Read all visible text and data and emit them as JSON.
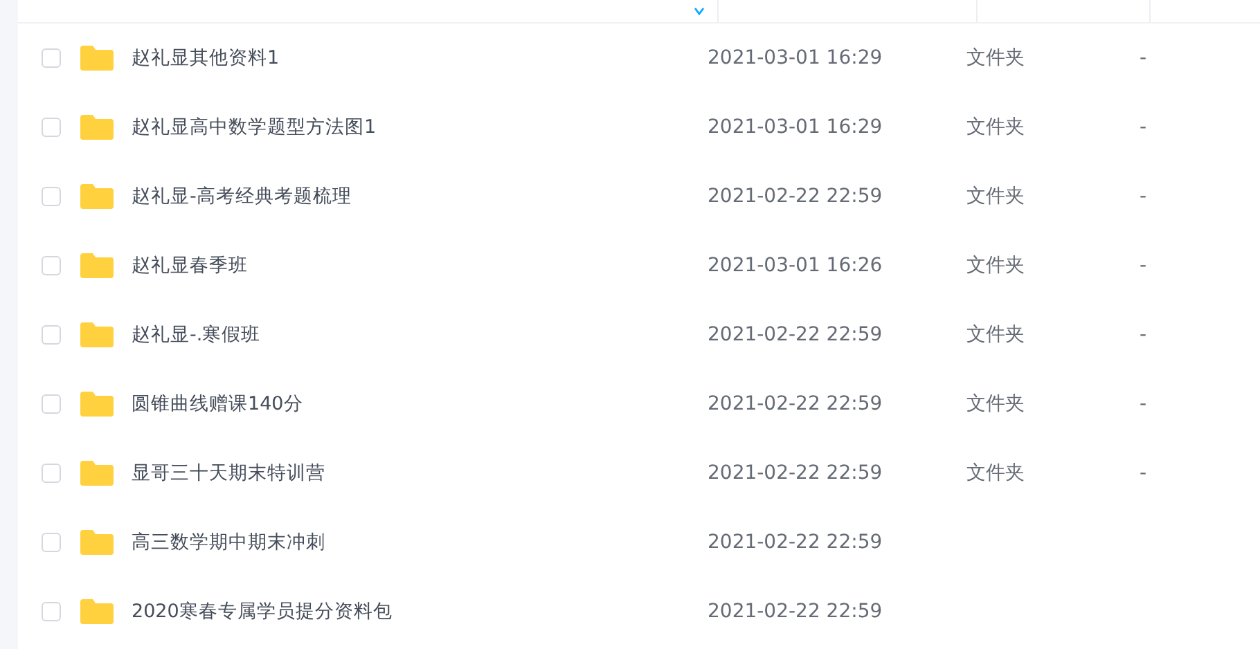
{
  "header": {
    "columns": [
      {
        "sorted": true
      },
      {
        "sorted": false
      },
      {
        "sorted": false
      },
      {
        "sorted": false
      }
    ]
  },
  "rows": [
    {
      "name": "赵礼显其他资料1",
      "modified": "2021-03-01 16:29",
      "type": "文件夹",
      "size": "-",
      "checked": false
    },
    {
      "name": "赵礼显高中数学题型方法图1",
      "modified": "2021-03-01 16:29",
      "type": "文件夹",
      "size": "-",
      "checked": false
    },
    {
      "name": "赵礼显-高考经典考题梳理",
      "modified": "2021-02-22 22:59",
      "type": "文件夹",
      "size": "-",
      "checked": false
    },
    {
      "name": "赵礼显春季班",
      "modified": "2021-03-01 16:26",
      "type": "文件夹",
      "size": "-",
      "checked": false
    },
    {
      "name": "赵礼显-.寒假班",
      "modified": "2021-02-22 22:59",
      "type": "文件夹",
      "size": "-",
      "checked": false
    },
    {
      "name": "圆锥曲线赠课140分",
      "modified": "2021-02-22 22:59",
      "type": "文件夹",
      "size": "-",
      "checked": false
    },
    {
      "name": "显哥三十天期末特训营",
      "modified": "2021-02-22 22:59",
      "type": "文件夹",
      "size": "-",
      "checked": false
    },
    {
      "name": "高三数学期中期末冲刺",
      "modified": "2021-02-22 22:59",
      "checked": false
    },
    {
      "name": "2020寒春专属学员提分资料包",
      "modified": "2021-02-22 22:59",
      "checked": false
    }
  ]
}
